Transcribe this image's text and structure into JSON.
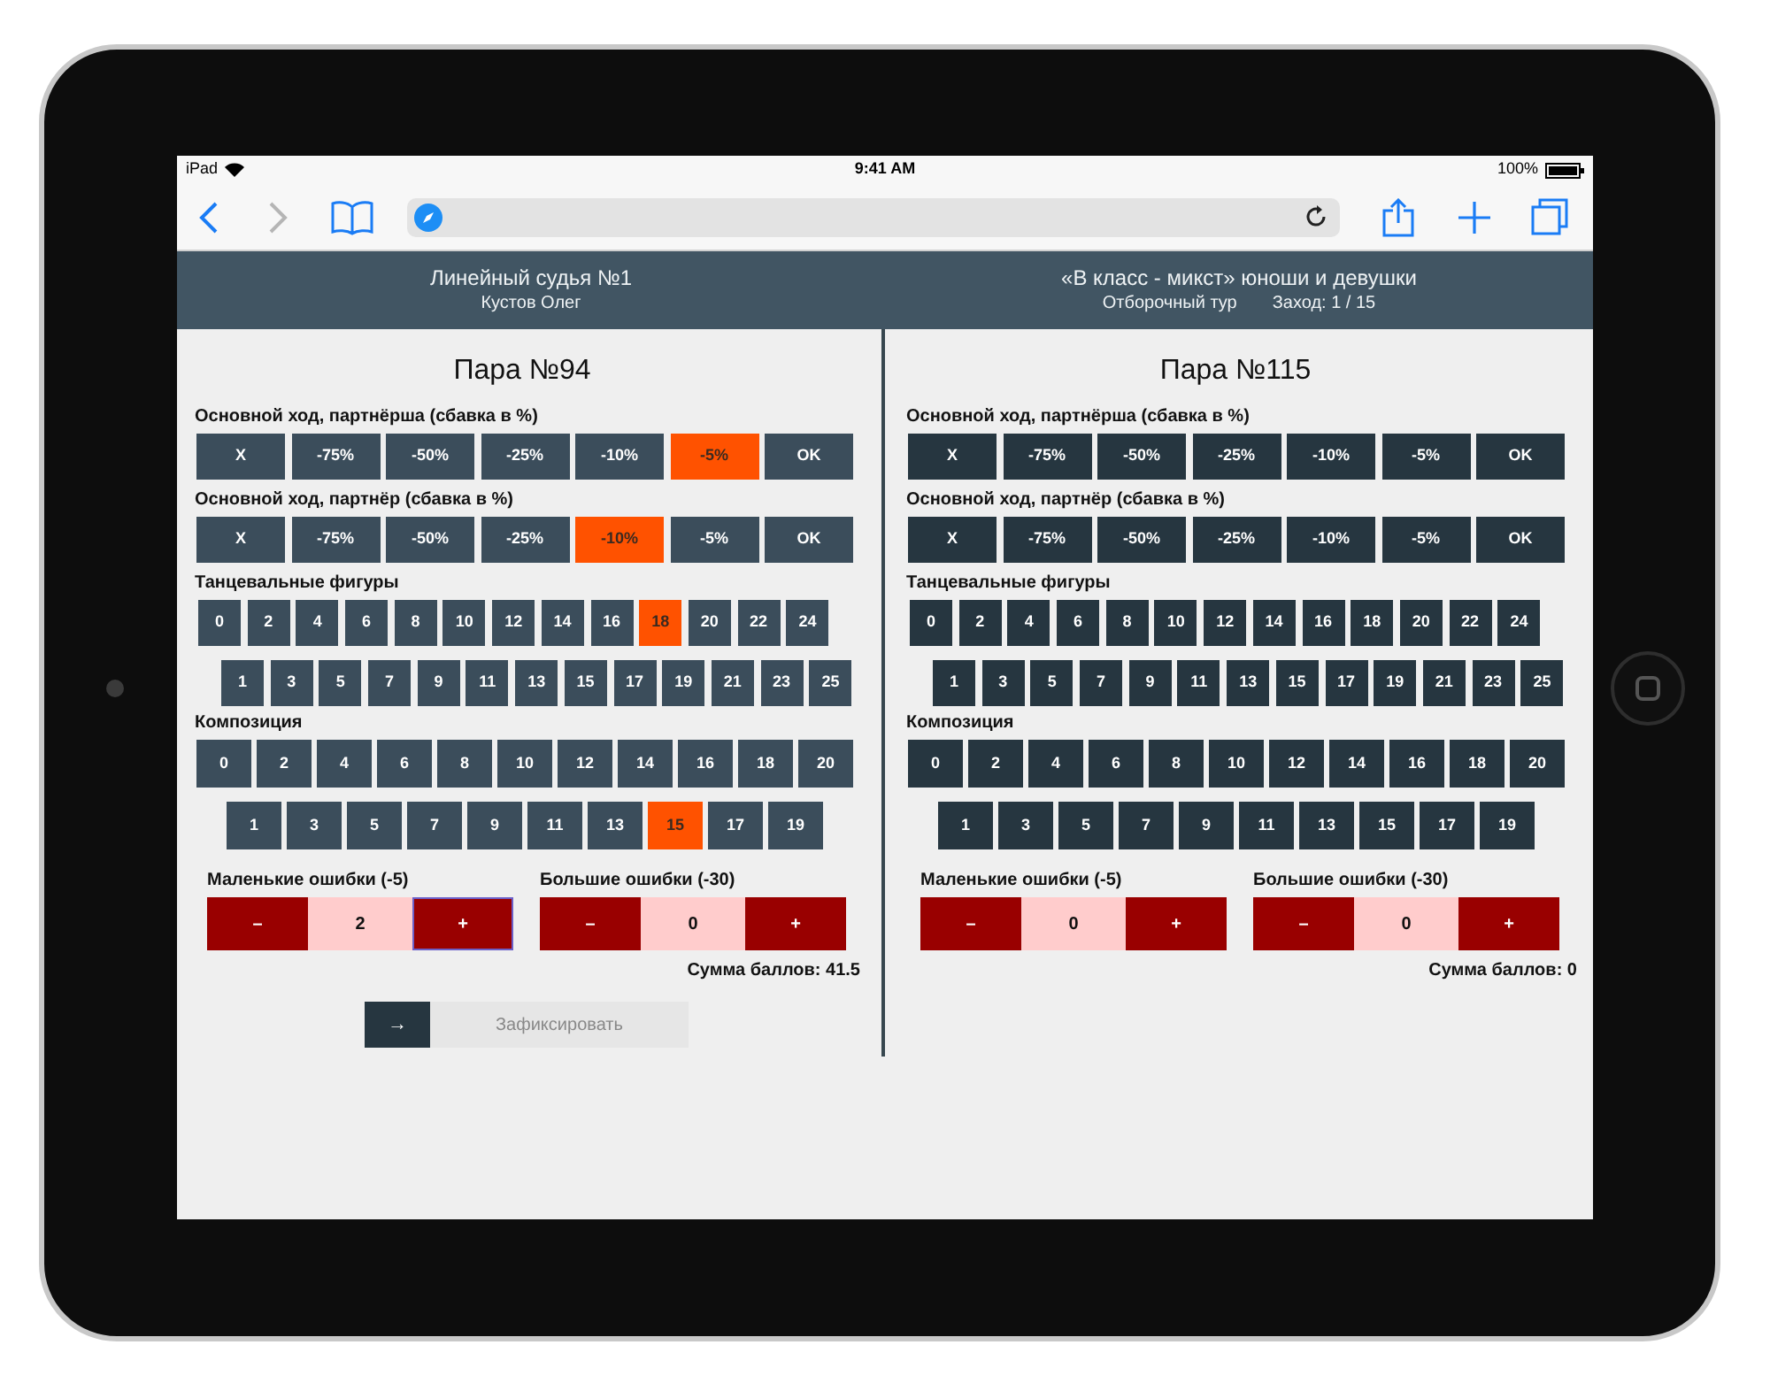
{
  "status_bar": {
    "carrier": "iPad",
    "time": "9:41 AM",
    "battery": "100%"
  },
  "header": {
    "judge_title": "Линейный судья №1",
    "judge_name": "Кустов Олег",
    "event_title": "«В класс - микст» юноши и девушки",
    "round": "Отборочный тур",
    "heat": "Заход: 1 / 15"
  },
  "pairs": [
    {
      "title": "Пара №94",
      "active": true,
      "sections": [
        {
          "kind": "percent",
          "label": "Основной ход, партнёрша (сбавка в %)",
          "rows": [
            [
              {
                "label": "X",
                "selected": false
              },
              {
                "label": "-75%",
                "selected": false
              },
              {
                "label": "-50%",
                "selected": false
              },
              {
                "label": "-25%",
                "selected": false
              },
              {
                "label": "-10%",
                "selected": false
              },
              {
                "label": "-5%",
                "selected": true
              },
              {
                "label": "OK",
                "selected": false
              }
            ]
          ]
        },
        {
          "kind": "percent",
          "label": "Основной ход, партнёр (сбавка в %)",
          "rows": [
            [
              {
                "label": "X",
                "selected": false
              },
              {
                "label": "-75%",
                "selected": false
              },
              {
                "label": "-50%",
                "selected": false
              },
              {
                "label": "-25%",
                "selected": false
              },
              {
                "label": "-10%",
                "selected": true
              },
              {
                "label": "-5%",
                "selected": false
              },
              {
                "label": "OK",
                "selected": false
              }
            ]
          ]
        },
        {
          "kind": "figures",
          "label": "Танцевальные фигуры",
          "rows": [
            [
              {
                "label": "0",
                "selected": false
              },
              {
                "label": "2",
                "selected": false
              },
              {
                "label": "4",
                "selected": false
              },
              {
                "label": "6",
                "selected": false
              },
              {
                "label": "8",
                "selected": false
              },
              {
                "label": "10",
                "selected": false
              },
              {
                "label": "12",
                "selected": false
              },
              {
                "label": "14",
                "selected": false
              },
              {
                "label": "16",
                "selected": false
              },
              {
                "label": "18",
                "selected": true
              },
              {
                "label": "20",
                "selected": false
              },
              {
                "label": "22",
                "selected": false
              },
              {
                "label": "24",
                "selected": false
              }
            ],
            [
              {
                "label": "1",
                "selected": false
              },
              {
                "label": "3",
                "selected": false
              },
              {
                "label": "5",
                "selected": false
              },
              {
                "label": "7",
                "selected": false
              },
              {
                "label": "9",
                "selected": false
              },
              {
                "label": "11",
                "selected": false
              },
              {
                "label": "13",
                "selected": false
              },
              {
                "label": "15",
                "selected": false
              },
              {
                "label": "17",
                "selected": false
              },
              {
                "label": "19",
                "selected": false
              },
              {
                "label": "21",
                "selected": false
              },
              {
                "label": "23",
                "selected": false
              },
              {
                "label": "25",
                "selected": false
              }
            ]
          ]
        },
        {
          "kind": "composition",
          "label": "Композиция",
          "rows": [
            [
              {
                "label": "0",
                "selected": false
              },
              {
                "label": "2",
                "selected": false
              },
              {
                "label": "4",
                "selected": false
              },
              {
                "label": "6",
                "selected": false
              },
              {
                "label": "8",
                "selected": false
              },
              {
                "label": "10",
                "selected": false
              },
              {
                "label": "12",
                "selected": false
              },
              {
                "label": "14",
                "selected": false
              },
              {
                "label": "16",
                "selected": false
              },
              {
                "label": "18",
                "selected": false
              },
              {
                "label": "20",
                "selected": false
              }
            ],
            [
              {
                "label": "1",
                "selected": false
              },
              {
                "label": "3",
                "selected": false
              },
              {
                "label": "5",
                "selected": false
              },
              {
                "label": "7",
                "selected": false
              },
              {
                "label": "9",
                "selected": false
              },
              {
                "label": "11",
                "selected": false
              },
              {
                "label": "13",
                "selected": false
              },
              {
                "label": "15",
                "selected": true
              },
              {
                "label": "17",
                "selected": false
              },
              {
                "label": "19",
                "selected": false
              }
            ]
          ]
        }
      ],
      "errors": [
        {
          "label": "Маленькие ошибки (-5)",
          "minus": "–",
          "value": "2",
          "plus": "+",
          "plus_focused": true
        },
        {
          "label": "Большие ошибки (-30)",
          "minus": "–",
          "value": "0",
          "plus": "+",
          "plus_focused": false
        }
      ],
      "total": "Сумма баллов: 41.5",
      "submit": {
        "arrow": "→",
        "label": "Зафиксировать",
        "disabled": true
      }
    },
    {
      "title": "Пара №115",
      "active": false,
      "sections": [
        {
          "kind": "percent",
          "label": "Основной ход, партнёрша (сбавка в %)",
          "rows": [
            [
              {
                "label": "X",
                "selected": false
              },
              {
                "label": "-75%",
                "selected": false
              },
              {
                "label": "-50%",
                "selected": false
              },
              {
                "label": "-25%",
                "selected": false
              },
              {
                "label": "-10%",
                "selected": false
              },
              {
                "label": "-5%",
                "selected": false
              },
              {
                "label": "OK",
                "selected": false
              }
            ]
          ]
        },
        {
          "kind": "percent",
          "label": "Основной ход, партнёр (сбавка в %)",
          "rows": [
            [
              {
                "label": "X",
                "selected": false
              },
              {
                "label": "-75%",
                "selected": false
              },
              {
                "label": "-50%",
                "selected": false
              },
              {
                "label": "-25%",
                "selected": false
              },
              {
                "label": "-10%",
                "selected": false
              },
              {
                "label": "-5%",
                "selected": false
              },
              {
                "label": "OK",
                "selected": false
              }
            ]
          ]
        },
        {
          "kind": "figures",
          "label": "Танцевальные фигуры",
          "rows": [
            [
              {
                "label": "0",
                "selected": false
              },
              {
                "label": "2",
                "selected": false
              },
              {
                "label": "4",
                "selected": false
              },
              {
                "label": "6",
                "selected": false
              },
              {
                "label": "8",
                "selected": false
              },
              {
                "label": "10",
                "selected": false
              },
              {
                "label": "12",
                "selected": false
              },
              {
                "label": "14",
                "selected": false
              },
              {
                "label": "16",
                "selected": false
              },
              {
                "label": "18",
                "selected": false
              },
              {
                "label": "20",
                "selected": false
              },
              {
                "label": "22",
                "selected": false
              },
              {
                "label": "24",
                "selected": false
              }
            ],
            [
              {
                "label": "1",
                "selected": false
              },
              {
                "label": "3",
                "selected": false
              },
              {
                "label": "5",
                "selected": false
              },
              {
                "label": "7",
                "selected": false
              },
              {
                "label": "9",
                "selected": false
              },
              {
                "label": "11",
                "selected": false
              },
              {
                "label": "13",
                "selected": false
              },
              {
                "label": "15",
                "selected": false
              },
              {
                "label": "17",
                "selected": false
              },
              {
                "label": "19",
                "selected": false
              },
              {
                "label": "21",
                "selected": false
              },
              {
                "label": "23",
                "selected": false
              },
              {
                "label": "25",
                "selected": false
              }
            ]
          ]
        },
        {
          "kind": "composition",
          "label": "Композиция",
          "rows": [
            [
              {
                "label": "0",
                "selected": false
              },
              {
                "label": "2",
                "selected": false
              },
              {
                "label": "4",
                "selected": false
              },
              {
                "label": "6",
                "selected": false
              },
              {
                "label": "8",
                "selected": false
              },
              {
                "label": "10",
                "selected": false
              },
              {
                "label": "12",
                "selected": false
              },
              {
                "label": "14",
                "selected": false
              },
              {
                "label": "16",
                "selected": false
              },
              {
                "label": "18",
                "selected": false
              },
              {
                "label": "20",
                "selected": false
              }
            ],
            [
              {
                "label": "1",
                "selected": false
              },
              {
                "label": "3",
                "selected": false
              },
              {
                "label": "5",
                "selected": false
              },
              {
                "label": "7",
                "selected": false
              },
              {
                "label": "9",
                "selected": false
              },
              {
                "label": "11",
                "selected": false
              },
              {
                "label": "13",
                "selected": false
              },
              {
                "label": "15",
                "selected": false
              },
              {
                "label": "17",
                "selected": false
              },
              {
                "label": "19",
                "selected": false
              }
            ]
          ]
        }
      ],
      "errors": [
        {
          "label": "Маленькие ошибки (-5)",
          "minus": "–",
          "value": "0",
          "plus": "+",
          "plus_focused": false
        },
        {
          "label": "Большие ошибки (-30)",
          "minus": "–",
          "value": "0",
          "plus": "+",
          "plus_focused": false
        }
      ],
      "total": "Сумма баллов: 0"
    }
  ]
}
